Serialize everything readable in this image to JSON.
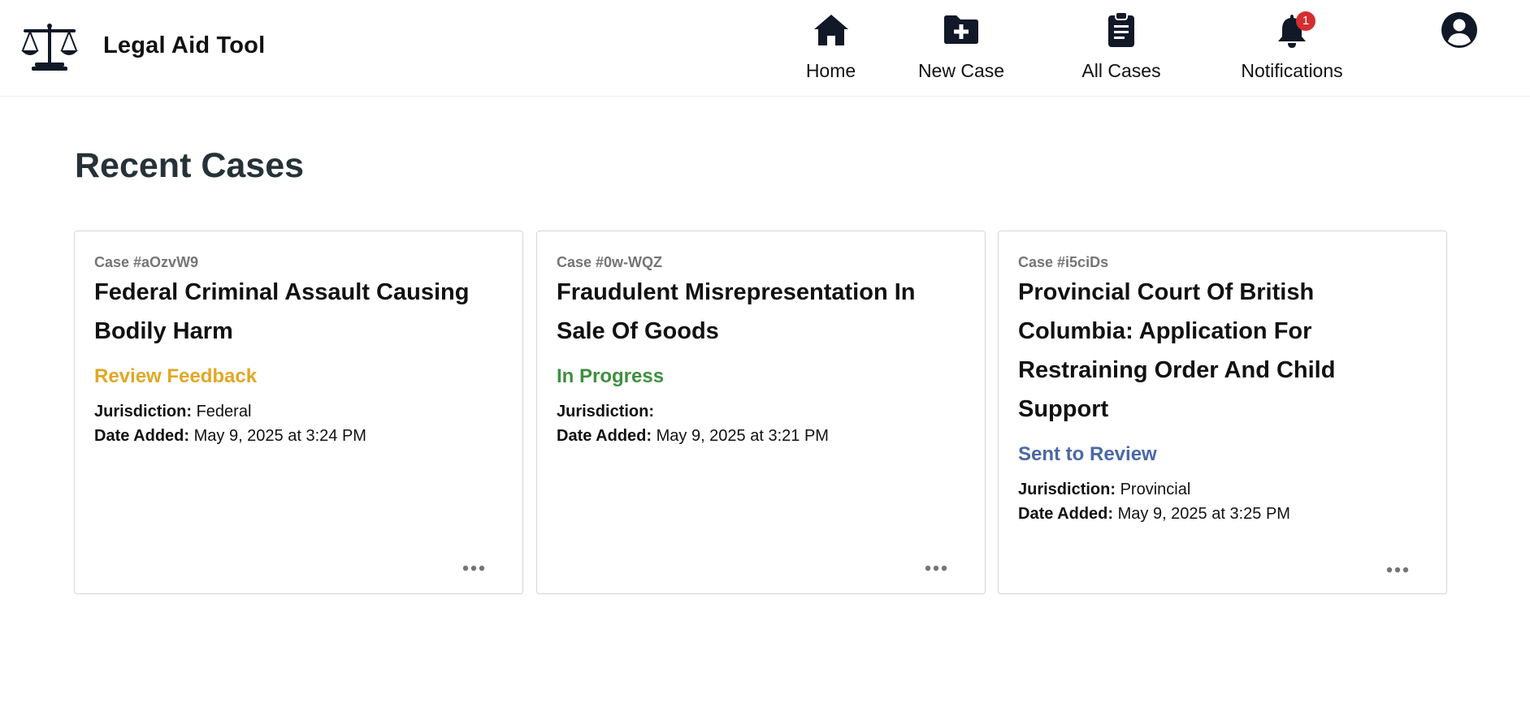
{
  "app": {
    "title": "Legal Aid Tool",
    "logo_icon": "scales-of-justice-icon"
  },
  "nav": {
    "items": [
      {
        "label": "Home",
        "icon": "home-icon"
      },
      {
        "label": "New Case",
        "icon": "folder-plus-icon"
      },
      {
        "label": "All Cases",
        "icon": "clipboard-list-icon"
      },
      {
        "label": "Notifications",
        "icon": "bell-icon",
        "badge": "1"
      }
    ],
    "profile_icon": "user-circle-icon"
  },
  "main": {
    "title": "Recent Cases",
    "cards": [
      {
        "case_id": "Case #aOzvW9",
        "title": "Federal Criminal Assault Causing Bodily Harm",
        "status": "Review Feedback",
        "status_color": "#e0a824",
        "jurisdiction_label": "Jurisdiction:",
        "jurisdiction": "Federal",
        "date_label": "Date Added:",
        "date": "May 9, 2025 at 3:24 PM"
      },
      {
        "case_id": "Case #0w-WQZ",
        "title": "Fraudulent Misrepresentation In Sale Of Goods",
        "status": "In Progress",
        "status_color": "#3f8f3f",
        "jurisdiction_label": "Jurisdiction:",
        "jurisdiction": "",
        "date_label": "Date Added:",
        "date": "May 9, 2025 at 3:21 PM"
      },
      {
        "case_id": "Case #i5ciDs",
        "title": "Provincial Court Of British Columbia: Application For Restraining Order And Child Support",
        "status": "Sent to Review",
        "status_color": "#4a67a8",
        "jurisdiction_label": "Jurisdiction:",
        "jurisdiction": "Provincial",
        "date_label": "Date Added:",
        "date": "May 9, 2025 at 3:25 PM"
      }
    ]
  },
  "colors": {
    "icon": "#111827",
    "title": "#263238",
    "badge": "#d32f2f"
  }
}
